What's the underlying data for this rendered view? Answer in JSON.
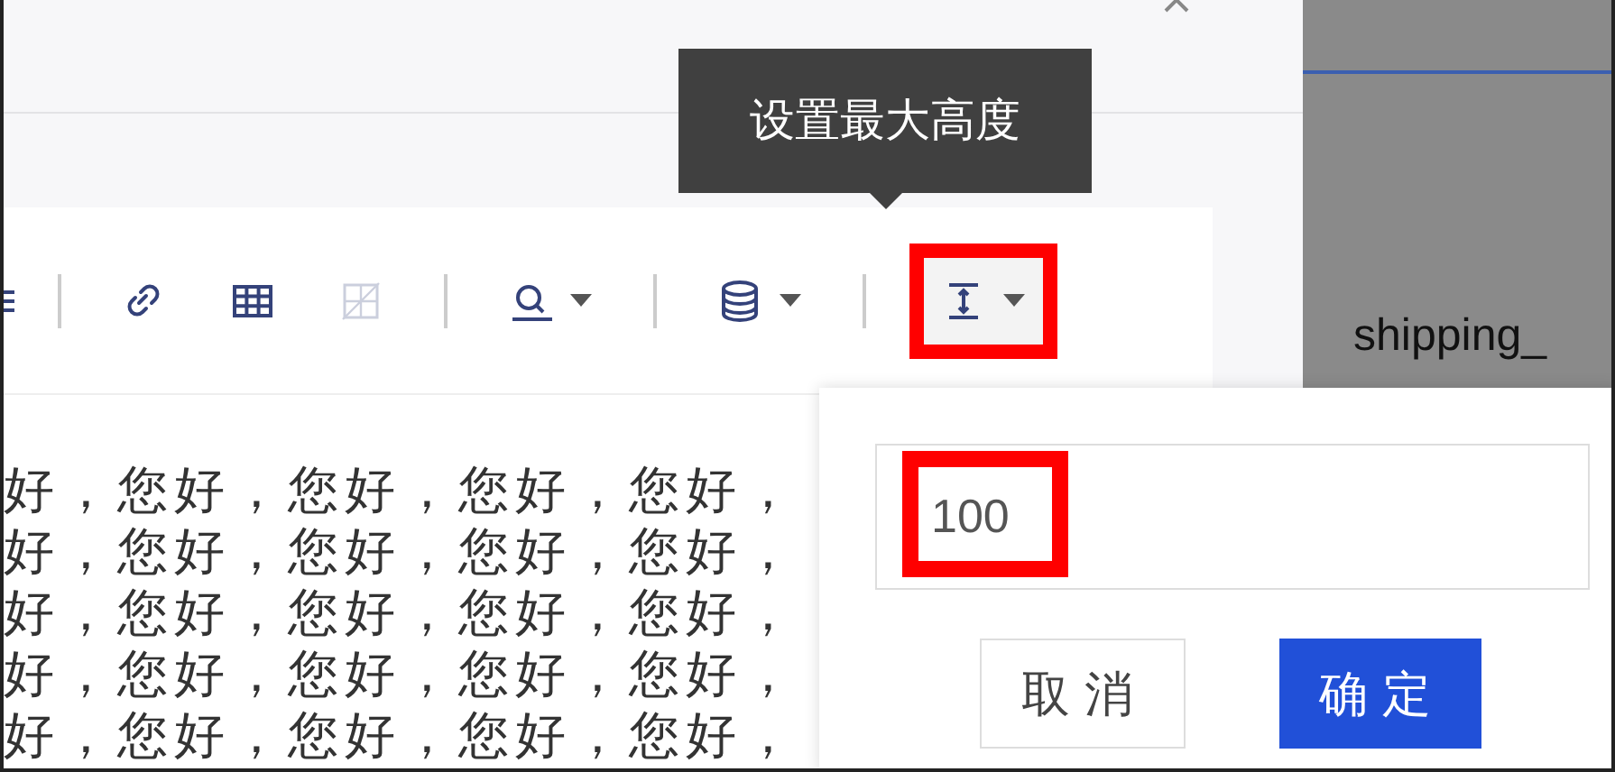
{
  "tooltip": {
    "text": "设置最大高度"
  },
  "toolbar": {
    "items": [
      {
        "kind": "list",
        "disabled": false,
        "dropdown": false,
        "highlighted": false
      },
      {
        "kind": "separator"
      },
      {
        "kind": "link",
        "disabled": false,
        "dropdown": false,
        "highlighted": false
      },
      {
        "kind": "table",
        "disabled": false,
        "dropdown": false,
        "highlighted": false
      },
      {
        "kind": "merge",
        "disabled": true,
        "dropdown": false,
        "highlighted": false
      },
      {
        "kind": "separator"
      },
      {
        "kind": "search",
        "disabled": false,
        "dropdown": true,
        "highlighted": false
      },
      {
        "kind": "separator"
      },
      {
        "kind": "database",
        "disabled": false,
        "dropdown": true,
        "highlighted": false
      },
      {
        "kind": "separator"
      },
      {
        "kind": "height",
        "disabled": false,
        "dropdown": true,
        "highlighted": true
      }
    ]
  },
  "editor": {
    "lines": [
      "好，您好，您好，您好，您好，",
      "好，您好，您好，您好，您好，",
      "好，您好，您好，您好，您好，",
      "好，您好，您好，您好，您好，",
      "好，您好，您好，您好，您好，"
    ]
  },
  "popup": {
    "input": {
      "value": "100",
      "highlighted": true
    },
    "buttons": [
      {
        "label": "取消",
        "kind": "secondary"
      },
      {
        "label": "确定",
        "kind": "primary"
      }
    ]
  },
  "background": {
    "label": "shipping_"
  }
}
